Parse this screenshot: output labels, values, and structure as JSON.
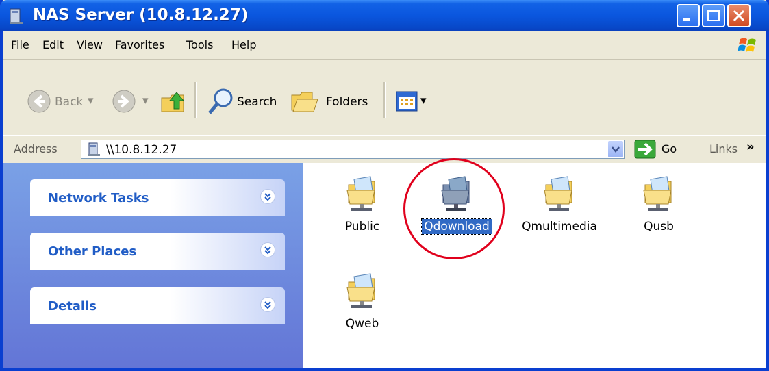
{
  "window": {
    "title": "NAS Server (10.8.12.27)"
  },
  "menu": {
    "items": [
      "File",
      "Edit",
      "View",
      "Favorites",
      "Tools",
      "Help"
    ]
  },
  "toolbar": {
    "back": "Back",
    "search": "Search",
    "folders": "Folders"
  },
  "address": {
    "label": "Address",
    "value": "\\\\10.8.12.27",
    "go": "Go",
    "links": "Links"
  },
  "taskpane": {
    "panels": [
      "Network Tasks",
      "Other Places",
      "Details"
    ]
  },
  "shares": [
    {
      "name": "Public",
      "selected": false
    },
    {
      "name": "Qdownload",
      "selected": true
    },
    {
      "name": "Qmultimedia",
      "selected": false
    },
    {
      "name": "Qusb",
      "selected": false
    },
    {
      "name": "Qweb",
      "selected": false
    }
  ],
  "colors": {
    "titlebar": "#0a56de",
    "taskpane": "#6f8de0",
    "selection": "#316ac5",
    "annotation": "#e0001c"
  }
}
